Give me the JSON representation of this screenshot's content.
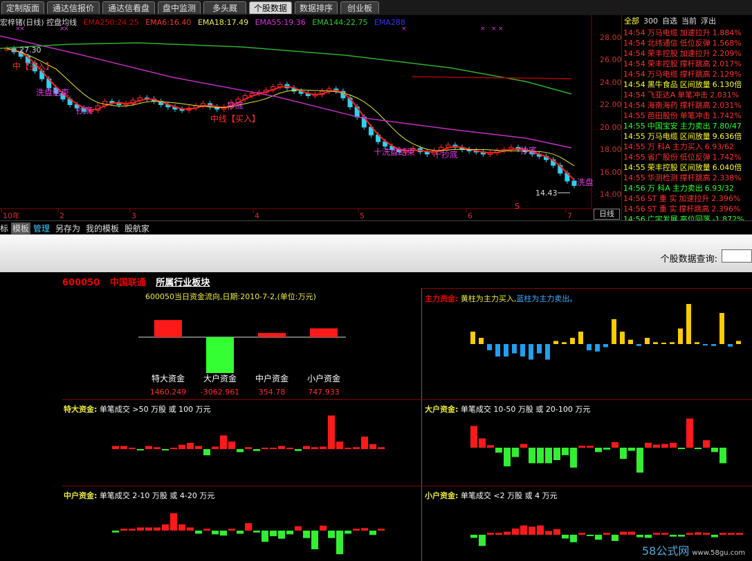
{
  "tabs": [
    "定制版面",
    "通达信报价",
    "通达信看盘",
    "盘中监测",
    "多头厩",
    "个股数据",
    "数据排序",
    "创业板"
  ],
  "active_tab": 5,
  "chart_title": {
    "name": "宏梓锗(日线) 控盘均线",
    "ema250": "EMA250:24.25",
    "ema6": "EMA6:16.40",
    "ema18": "EMA18:17.49",
    "ema55": "EMA55:19.36",
    "ema144": "EMA144:22.75",
    "ema288": "EMA288"
  },
  "chart_annotations": {
    "high_price": "27.30",
    "low_price": "14.43",
    "buy1": "中【买入】",
    "wash_end": "洗盘结束",
    "dip1": "抄底",
    "buy2": "中线【买入】",
    "dip2": "抄底",
    "wash2": "十洗盘结束",
    "dip3": "十抄底",
    "dip4": "抄底",
    "wash3": "洗盘",
    "s_mark": "S"
  },
  "price_axis": [
    "28.00",
    "26.00",
    "24.00",
    "22.00",
    "20.00",
    "18.00",
    "16.00",
    "14.00"
  ],
  "time_axis": [
    "10年",
    "2",
    "3",
    "4",
    "5",
    "6",
    "7"
  ],
  "period_label": "日线",
  "right_list": {
    "header": [
      "全部",
      "300",
      "自选",
      "当前",
      "浮出"
    ],
    "rows": [
      {
        "t": "14:54",
        "n": "万马电缆",
        "k": "加速拉升",
        "v": "1.884%",
        "c": "#ff3333"
      },
      {
        "t": "14:54",
        "n": "北纬通信",
        "k": "低位反弹",
        "v": "1.568%",
        "c": "#ff3333"
      },
      {
        "t": "14:54",
        "n": "荣丰控股",
        "k": "加速拉升",
        "v": "2.209%",
        "c": "#ff3333"
      },
      {
        "t": "14:54",
        "n": "荣丰控股",
        "k": "撑杆跳高",
        "v": "2.017%",
        "c": "#ff3333"
      },
      {
        "t": "14:54",
        "n": "万马电缆",
        "k": "撑杆跳高",
        "v": "2.129%",
        "c": "#ff3333"
      },
      {
        "t": "14:54",
        "n": "黑牛食品",
        "k": "区间放量",
        "v": "6.130倍",
        "c": "#ffff33"
      },
      {
        "t": "14:54",
        "n": "飞亚达A",
        "k": "单笔冲击",
        "v": "2.031%",
        "c": "#ff3333"
      },
      {
        "t": "14:54",
        "n": "海南海药",
        "k": "撑杆跳高",
        "v": "2.031%",
        "c": "#ff3333"
      },
      {
        "t": "14:55",
        "n": "芭田股份",
        "k": "单笔冲击",
        "v": "1.742%",
        "c": "#ff3333"
      },
      {
        "t": "14:55",
        "n": "中国宝安",
        "k": "主力卖出",
        "v": "7.80/47",
        "c": "#33ff33"
      },
      {
        "t": "14:55",
        "n": "万马电缆",
        "k": "区间放量",
        "v": "9.636倍",
        "c": "#ffff33"
      },
      {
        "t": "14:55",
        "n": "万  科A",
        "k": "主力买入",
        "v": "6.93/62",
        "c": "#ff3333"
      },
      {
        "t": "14:55",
        "n": "省广股份",
        "k": "低位反弹",
        "v": "1.742%",
        "c": "#ff3333"
      },
      {
        "t": "14:55",
        "n": "荣丰控股",
        "k": "区间放量",
        "v": "6.040倍",
        "c": "#ffff33"
      },
      {
        "t": "14:55",
        "n": "华测检测",
        "k": "撑杆跳高",
        "v": "2.338%",
        "c": "#ff3333"
      },
      {
        "t": "14:56",
        "n": "万  科A",
        "k": "主力卖出",
        "v": "6.93/32",
        "c": "#33ff33"
      },
      {
        "t": "14:56",
        "n": "ST 重 实",
        "k": "加速拉升",
        "v": "2.396%",
        "c": "#ff3333"
      },
      {
        "t": "14:56",
        "n": "ST 重 实",
        "k": "撑杆跳高",
        "v": "2.396%",
        "c": "#ff3333"
      },
      {
        "t": "14:56",
        "n": "广宇发展",
        "k": "高位回落",
        "v": "-1.872%",
        "c": "#33ff33"
      }
    ]
  },
  "toolbar": [
    "标",
    "模板",
    "管理",
    "另存为",
    "我的模板",
    "股航家"
  ],
  "query_label": "个股数据查询:",
  "stock": {
    "code": "600050",
    "name": "中国联通",
    "sector": "所属行业板块"
  },
  "fund_flow": {
    "title": "600050当日资金流向,日期:2010-7-2,(单位:万元)",
    "categories": [
      "特大资金",
      "大户资金",
      "中户资金",
      "小户资金"
    ],
    "values": [
      1460.249,
      -3062.961,
      354.78,
      747.933
    ],
    "value_labels": [
      "1460.249",
      "-3062.961",
      "354.78",
      "747.933"
    ]
  },
  "panels": {
    "main": {
      "label": "主力资金:",
      "desc1": "黄柱为主力买入,",
      "desc2": "蓝柱为主力卖出。"
    },
    "super": {
      "label": "特大资金:",
      "desc": "单笔成交 >50 万股 或 100 万元"
    },
    "large": {
      "label": "大户资金:",
      "desc": "单笔成交 10-50 万股 或 20-100 万元"
    },
    "medium": {
      "label": "中户资金:",
      "desc": "单笔成交 2-10 万股 或 4-20 万元"
    },
    "small": {
      "label": "小户资金:",
      "desc": "单笔成交 <2 万股 或 4 万元"
    }
  },
  "chart_data": [
    {
      "type": "bar",
      "title": "主力资金",
      "values": [
        2,
        1,
        -1,
        -2,
        -2,
        -1.5,
        -2,
        -2.5,
        -1.5,
        -2.5,
        0.5,
        0.3,
        1,
        2,
        -1,
        -1.2,
        -0.5,
        4,
        2,
        0.7,
        -0.3,
        1,
        0.3,
        0.2,
        0.3,
        2.5,
        7,
        0.3,
        -0.2,
        -0.3,
        5,
        -0.4,
        0.5,
        -0.6
      ]
    },
    {
      "type": "bar",
      "title": "特大资金",
      "values": [
        0.5,
        0.5,
        0.2,
        -0.2,
        0.5,
        0.3,
        -0.2,
        0.2,
        0.7,
        1.0,
        0.5,
        -1,
        0.4,
        2.2,
        1.2,
        -0.5,
        0.3,
        -0.3,
        0.2,
        0.2,
        0.5,
        0.2,
        -0.3,
        0.5,
        0.3,
        0.4,
        5.4,
        1.2,
        0.2,
        0.3,
        2.0,
        0.8,
        0.3,
        0.3
      ]
    },
    {
      "type": "bar",
      "title": "大户资金",
      "values": [
        3.5,
        1.5,
        0.4,
        -0.8,
        -3,
        -1.5,
        0.6,
        -2.5,
        -2.5,
        -2.5,
        -2,
        -1.2,
        -3.2,
        0.3,
        0.3,
        -0.7,
        -0.3,
        0.9,
        -1.8,
        -0.5,
        -4,
        0.8,
        0.5,
        0.6,
        0.8,
        -0.2,
        4.7,
        -0.2,
        1.2,
        -0.7,
        -2.5
      ]
    },
    {
      "type": "bar",
      "title": "中户资金",
      "values": [
        -0.3,
        0.3,
        0.3,
        0.5,
        0.5,
        0.5,
        1,
        2.8,
        1,
        0.5,
        -0.5,
        0.3,
        -0.6,
        -0.8,
        0.3,
        -0.5,
        1.2,
        -0.3,
        -1.8,
        -0.9,
        -1.3,
        -0.6,
        0.7,
        -1.2,
        -3,
        0.8,
        -1.2,
        -3.8,
        -0.5,
        0.3,
        0.4,
        -0.7,
        0.3,
        1.1
      ]
    },
    {
      "type": "bar",
      "title": "小户资金",
      "values": [
        -0.5,
        -1.8,
        0.3,
        0.3,
        0.5,
        1,
        1.5,
        1.3,
        1.5,
        0.6,
        0.9,
        -0.6,
        -1.2,
        0.3,
        -0.2,
        -0.8,
        0.3,
        -1,
        0.5,
        0.5,
        -0.4,
        -0.5,
        0.3,
        0.3,
        -0.3,
        -0.3,
        0.3,
        0.4,
        0.3,
        -0.4,
        0.3,
        0.3,
        0.3,
        -0.3
      ]
    }
  ],
  "watermark": {
    "brand": "58公式网",
    "site": "www.58gu.com"
  }
}
